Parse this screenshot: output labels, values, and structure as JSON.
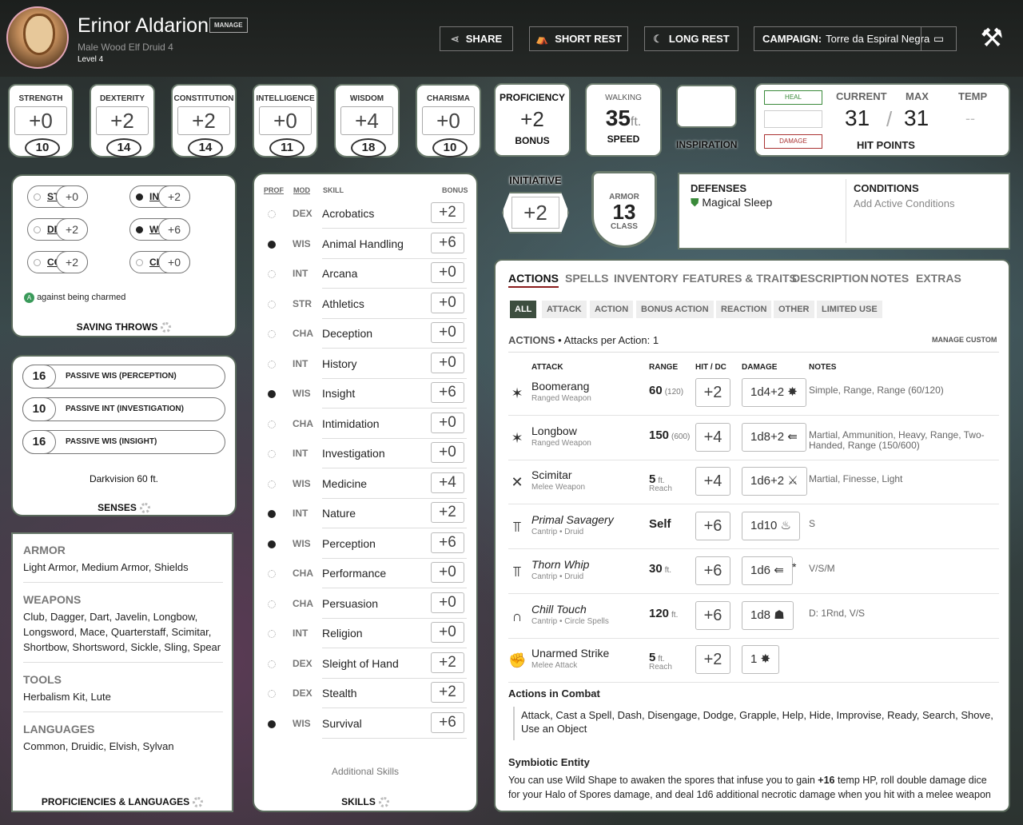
{
  "header": {
    "name": "Erinor Aldarion",
    "manage": "MANAGE",
    "subtitle": "Male  Wood Elf  Druid 4",
    "level": "Level 4",
    "share": "SHARE",
    "short_rest": "SHORT REST",
    "long_rest": "LONG REST",
    "campaign_label": "CAMPAIGN:",
    "campaign_value": "Torre da Espiral Negra"
  },
  "abilities": [
    {
      "label": "STRENGTH",
      "mod": "+0",
      "score": "10"
    },
    {
      "label": "DEXTERITY",
      "mod": "+2",
      "score": "14"
    },
    {
      "label": "CONSTITUTION",
      "mod": "+2",
      "score": "14"
    },
    {
      "label": "INTELLIGENCE",
      "mod": "+0",
      "score": "11"
    },
    {
      "label": "WISDOM",
      "mod": "+4",
      "score": "18"
    },
    {
      "label": "CHARISMA",
      "mod": "+0",
      "score": "10"
    }
  ],
  "proficiency": {
    "label": "PROFICIENCY",
    "value": "+2",
    "sub": "BONUS"
  },
  "speed": {
    "label": "WALKING",
    "value": "35",
    "unit": "ft.",
    "sub": "SPEED"
  },
  "inspiration": {
    "label": "INSPIRATION"
  },
  "hp": {
    "heal": "HEAL",
    "damage": "DAMAGE",
    "current_label": "CURRENT",
    "max_label": "MAX",
    "temp_label": "TEMP",
    "current": "31",
    "max": "31",
    "temp": "--",
    "title": "HIT POINTS"
  },
  "initiative": {
    "label": "INITIATIVE",
    "value": "+2"
  },
  "armor": {
    "label": "ARMOR",
    "value": "13",
    "sub": "CLASS"
  },
  "defenses": {
    "title": "DEFENSES",
    "item": "Magical Sleep"
  },
  "conditions": {
    "title": "CONDITIONS",
    "add": "Add Active Conditions"
  },
  "saves": {
    "items": [
      {
        "ab": "STR",
        "val": "+0",
        "prof": false
      },
      {
        "ab": "INT",
        "val": "+2",
        "prof": true
      },
      {
        "ab": "DEX",
        "val": "+2",
        "prof": false
      },
      {
        "ab": "WIS",
        "val": "+6",
        "prof": true
      },
      {
        "ab": "CON",
        "val": "+2",
        "prof": false
      },
      {
        "ab": "CHA",
        "val": "+0",
        "prof": false
      }
    ],
    "note": "against being charmed",
    "title": "SAVING THROWS"
  },
  "senses": {
    "items": [
      {
        "n": "16",
        "t": "PASSIVE WIS (PERCEPTION)"
      },
      {
        "n": "10",
        "t": "PASSIVE INT (INVESTIGATION)"
      },
      {
        "n": "16",
        "t": "PASSIVE WIS (INSIGHT)"
      }
    ],
    "darkvision": "Darkvision 60 ft.",
    "title": "SENSES"
  },
  "profs": {
    "armor_h": "ARMOR",
    "armor": "Light Armor, Medium Armor, Shields",
    "weapons_h": "WEAPONS",
    "weapons": "Club, Dagger, Dart, Javelin, Longbow, Longsword, Mace, Quarterstaff, Scimitar, Shortbow, Shortsword, Sickle, Sling, Spear",
    "tools_h": "TOOLS",
    "tools": "Herbalism Kit, Lute",
    "lang_h": "LANGUAGES",
    "lang": "Common, Druidic, Elvish, Sylvan",
    "title": "PROFICIENCIES & LANGUAGES"
  },
  "skills": {
    "h_prof": "PROF",
    "h_mod": "MOD",
    "h_skill": "SKILL",
    "h_bonus": "BONUS",
    "additional": "Additional Skills",
    "title": "SKILLS",
    "items": [
      {
        "md": "DEX",
        "nm": "Acrobatics",
        "bn": "+2",
        "p": false
      },
      {
        "md": "WIS",
        "nm": "Animal Handling",
        "bn": "+6",
        "p": true
      },
      {
        "md": "INT",
        "nm": "Arcana",
        "bn": "+0",
        "p": false
      },
      {
        "md": "STR",
        "nm": "Athletics",
        "bn": "+0",
        "p": false
      },
      {
        "md": "CHA",
        "nm": "Deception",
        "bn": "+0",
        "p": false
      },
      {
        "md": "INT",
        "nm": "History",
        "bn": "+0",
        "p": false
      },
      {
        "md": "WIS",
        "nm": "Insight",
        "bn": "+6",
        "p": true
      },
      {
        "md": "CHA",
        "nm": "Intimidation",
        "bn": "+0",
        "p": false
      },
      {
        "md": "INT",
        "nm": "Investigation",
        "bn": "+0",
        "p": false
      },
      {
        "md": "WIS",
        "nm": "Medicine",
        "bn": "+4",
        "p": false
      },
      {
        "md": "INT",
        "nm": "Nature",
        "bn": "+2",
        "p": true
      },
      {
        "md": "WIS",
        "nm": "Perception",
        "bn": "+6",
        "p": true
      },
      {
        "md": "CHA",
        "nm": "Performance",
        "bn": "+0",
        "p": false
      },
      {
        "md": "CHA",
        "nm": "Persuasion",
        "bn": "+0",
        "p": false
      },
      {
        "md": "INT",
        "nm": "Religion",
        "bn": "+0",
        "p": false
      },
      {
        "md": "DEX",
        "nm": "Sleight of Hand",
        "bn": "+2",
        "p": false
      },
      {
        "md": "DEX",
        "nm": "Stealth",
        "bn": "+2",
        "p": false
      },
      {
        "md": "WIS",
        "nm": "Survival",
        "bn": "+6",
        "p": true
      }
    ]
  },
  "tabs": [
    "ACTIONS",
    "SPELLS",
    "INVENTORY",
    "FEATURES & TRAITS",
    "DESCRIPTION",
    "NOTES",
    "EXTRAS"
  ],
  "filters": [
    "ALL",
    "ATTACK",
    "ACTION",
    "BONUS ACTION",
    "REACTION",
    "OTHER",
    "LIMITED USE"
  ],
  "actions": {
    "title": "ACTIONS",
    "per_action": "Attacks per Action: 1",
    "manage_custom": "MANAGE CUSTOM",
    "h_attack": "ATTACK",
    "h_range": "RANGE",
    "h_hit": "HIT / DC",
    "h_damage": "DAMAGE",
    "h_notes": "NOTES",
    "items": [
      {
        "nm": "Boomerang",
        "sb": "Ranged Weapon",
        "rg": "60",
        "rs2": "(120)",
        "rs": "",
        "hit": "+2",
        "dmg": "1d4+2",
        "dicon": "✸",
        "nt": "Simple, Range, Range (60/120)",
        "it": false,
        "icon": "✶"
      },
      {
        "nm": "Longbow",
        "sb": "Ranged Weapon",
        "rg": "150",
        "rs2": "(600)",
        "rs": "",
        "hit": "+4",
        "dmg": "1d8+2",
        "dicon": "⇚",
        "nt": "Martial, Ammunition, Heavy, Range, Two-Handed, Range (150/600)",
        "it": false,
        "icon": "✶"
      },
      {
        "nm": "Scimitar",
        "sb": "Melee Weapon",
        "rg": "5",
        "rs2": "ft.",
        "rs": "Reach",
        "hit": "+4",
        "dmg": "1d6+2",
        "dicon": "⚔",
        "nt": "Martial, Finesse, Light",
        "it": false,
        "icon": "✕"
      },
      {
        "nm": "Primal Savagery",
        "sb": "Cantrip • Druid",
        "rg": "Self",
        "rs2": "",
        "rs": "",
        "hit": "+6",
        "dmg": "1d10",
        "dicon": "♨",
        "nt": "S",
        "it": true,
        "icon": "⫪"
      },
      {
        "nm": "Thorn Whip",
        "sb": "Cantrip • Druid",
        "rg": "30",
        "rs2": "ft.",
        "rs": "",
        "hit": "+6",
        "dmg": "1d6",
        "dicon": "⇚",
        "nt": "V/S/M",
        "it": true,
        "icon": "⫪",
        "star": "*"
      },
      {
        "nm": "Chill Touch",
        "sb": "Cantrip • Circle Spells",
        "rg": "120",
        "rs2": "ft.",
        "rs": "",
        "hit": "+6",
        "dmg": "1d8",
        "dicon": "☗",
        "nt": "D: 1Rnd, V/S",
        "it": true,
        "icon": "∩"
      },
      {
        "nm": "Unarmed Strike",
        "sb": "Melee Attack",
        "rg": "5",
        "rs2": "ft.",
        "rs": "Reach",
        "hit": "+2",
        "dmg": "1",
        "dicon": "✸",
        "nt": "",
        "it": false,
        "icon": "✊"
      }
    ],
    "combat_h": "Actions in Combat",
    "combat": "Attack, Cast a Spell, Dash, Disengage, Dodge, Grapple, Help, Hide, Improvise, Ready, Search, Shove, Use an Object",
    "symb_h": "Symbiotic Entity",
    "symb_a": "You can use Wild Shape to awaken the spores that infuse you to gain ",
    "symb_b": "+16",
    "symb_c": " temp HP, roll double damage dice for your Halo of Spores damage, and deal 1d6 additional necrotic damage when you hit with a melee weapon"
  }
}
